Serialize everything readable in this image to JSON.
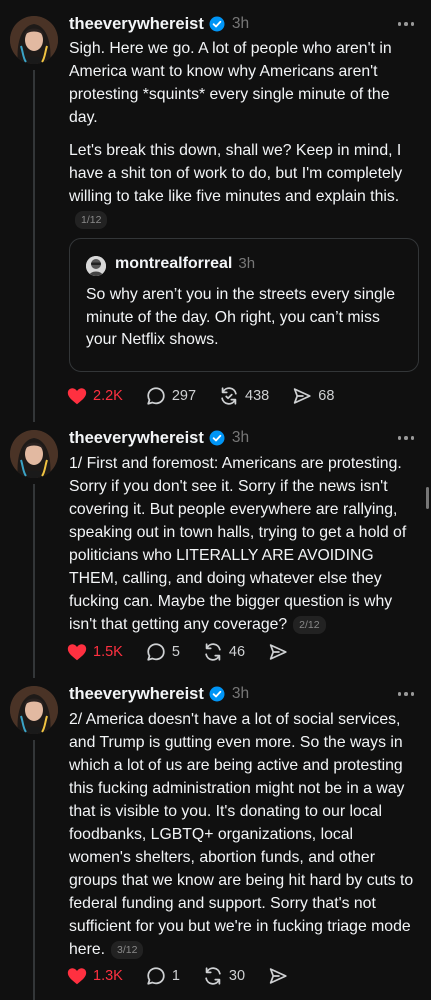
{
  "colors": {
    "background": "#101010",
    "text": "#f3f5f7",
    "muted": "#777777",
    "like_red": "#ff3040",
    "verified_blue": "#0095f6",
    "thread_line": "#333638"
  },
  "posts": [
    {
      "username": "theeverywhereist",
      "time": "3h",
      "paragraphs": [
        "Sigh. Here we go. A lot of people who aren't in America want to know why Americans aren't protesting *squints* every single minute of the day.",
        "Let's break this down, shall we? Keep in mind, I have a shit ton of work to do, but I'm completely willing to take like five minutes and explain this."
      ],
      "counter": "1/12",
      "quote": {
        "username": "montrealforreal",
        "time": "3h",
        "text": "So why aren’t you in the streets every single minute of the day.  Oh right, you can’t miss your Netflix shows."
      },
      "likes": "2.2K",
      "replies": "297",
      "reposts": "438",
      "shares": "68"
    },
    {
      "username": "theeverywhereist",
      "time": "3h",
      "paragraphs": [
        "1/ First and foremost: Americans are protesting. Sorry if you don't see it. Sorry if the news isn't covering it. But people everywhere are rallying, speaking out in town halls, trying to get a hold of politicians who LITERALLY ARE AVOIDING THEM, calling, and doing whatever else they fucking can. Maybe the bigger question is why isn't that getting any coverage?"
      ],
      "counter": "2/12",
      "likes": "1.5K",
      "replies": "5",
      "reposts": "46"
    },
    {
      "username": "theeverywhereist",
      "time": "3h",
      "paragraphs": [
        "2/ America doesn't have a lot of social services, and Trump is gutting even more. So the ways in which a lot of us are being active and protesting this fucking administration might not be in a way that is visible to you. It's donating to our local foodbanks, LGBTQ+ organizations, local women's shelters, abortion funds, and other groups that we know are being hit hard by cuts to federal funding and support. Sorry that's not sufficient for you but we're in fucking triage mode here."
      ],
      "counter": "3/12",
      "likes": "1.3K",
      "replies": "1",
      "reposts": "30"
    }
  ]
}
